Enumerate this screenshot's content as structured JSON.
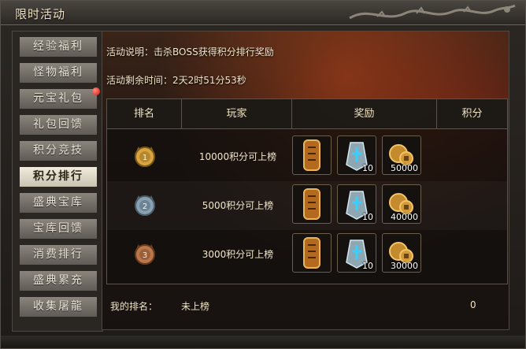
{
  "window": {
    "title": "限时活动"
  },
  "sidebar": {
    "items": [
      {
        "label": "经验福利",
        "active": false,
        "badge": false
      },
      {
        "label": "怪物福利",
        "active": false,
        "badge": false
      },
      {
        "label": "元宝礼包",
        "active": false,
        "badge": true
      },
      {
        "label": "礼包回馈",
        "active": false,
        "badge": false
      },
      {
        "label": "积分竞技",
        "active": false,
        "badge": false
      },
      {
        "label": "积分排行",
        "active": true,
        "badge": false
      },
      {
        "label": "盛典宝库",
        "active": false,
        "badge": false
      },
      {
        "label": "宝库回馈",
        "active": false,
        "badge": false
      },
      {
        "label": "消费排行",
        "active": false,
        "badge": false
      },
      {
        "label": "盛典累充",
        "active": false,
        "badge": false
      },
      {
        "label": "收集屠龍",
        "active": false,
        "badge": false
      }
    ]
  },
  "activity": {
    "description": "活动说明：击杀BOSS获得积分排行奖励",
    "time_remaining": "活动剩余时间：2天2时51分53秒"
  },
  "table": {
    "headers": {
      "rank": "排名",
      "player": "玩家",
      "reward": "奖励",
      "score": "积分"
    },
    "rows": [
      {
        "medal": "gold-medal-icon",
        "requirement": "10000积分可上榜",
        "reward_counts": [
          "",
          "10",
          "50000"
        ]
      },
      {
        "medal": "silver-medal-icon",
        "requirement": "5000积分可上榜",
        "reward_counts": [
          "",
          "10",
          "40000"
        ]
      },
      {
        "medal": "bronze-medal-icon",
        "requirement": "3000积分可上榜",
        "reward_counts": [
          "",
          "10",
          "30000"
        ]
      }
    ]
  },
  "my_rank": {
    "label": "我的排名：",
    "value": "未上榜",
    "score": "0"
  },
  "colors": {
    "gold": "#d9a441",
    "accent_red": "#d01a12",
    "active_tab": "#f1ecde"
  }
}
